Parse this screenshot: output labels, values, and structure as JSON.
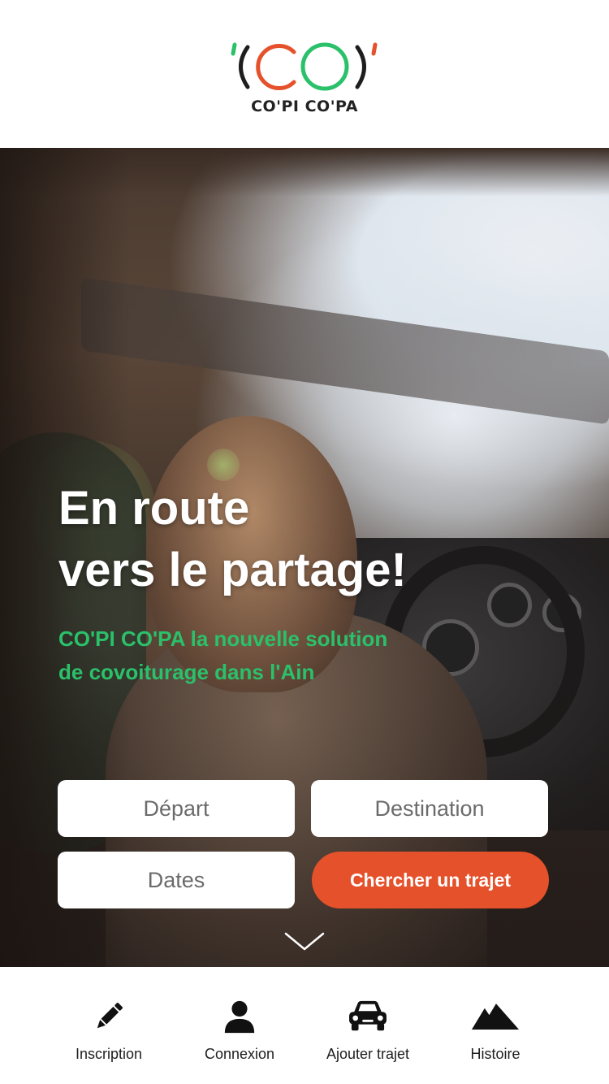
{
  "header": {
    "logo_mark": "'(CO)'",
    "logo_caption": "CO'PI CO'PA"
  },
  "hero": {
    "headline_line1": "En route",
    "headline_line2": "vers le partage!",
    "subtitle_line1": "CO'PI CO'PA la nouvelle solution",
    "subtitle_line2": "de covoiturage dans l'Ain"
  },
  "search": {
    "departure_placeholder": "Départ",
    "destination_placeholder": "Destination",
    "dates_placeholder": "Dates",
    "submit_label": "Chercher un trajet"
  },
  "nav": {
    "items": [
      {
        "label": "Inscription",
        "icon": "pencil-icon"
      },
      {
        "label": "Connexion",
        "icon": "user-icon"
      },
      {
        "label": "Ajouter trajet",
        "icon": "car-icon"
      },
      {
        "label": "Histoire",
        "icon": "mountain-icon"
      }
    ]
  },
  "colors": {
    "brand_orange": "#e5512a",
    "brand_green": "#2bc06a",
    "brand_dark": "#1e1e1e"
  }
}
